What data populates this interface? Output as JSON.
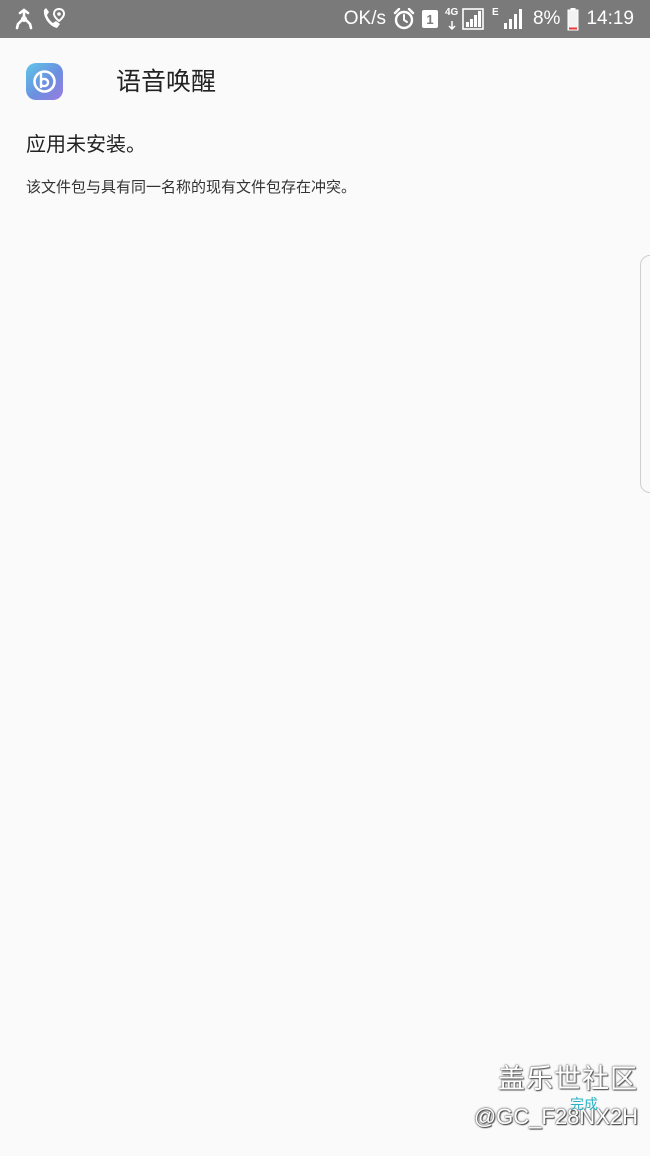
{
  "status_bar": {
    "network_speed": "OK/s",
    "sim_slot": "1",
    "network_4g": "4G",
    "network_e": "E",
    "battery_percent": "8%",
    "time": "14:19",
    "icons": [
      "usb-debug-icon",
      "wifi-calling-icon",
      "alarm-icon",
      "sim-slot-icon",
      "signal-4g-icon",
      "signal-e-icon",
      "battery-icon"
    ]
  },
  "app": {
    "title": "语音唤醒",
    "icon": "bixby-voice-icon"
  },
  "message": {
    "title": "应用未安装。",
    "body": "该文件包与具有同一名称的现有文件包存在冲突。"
  },
  "watermark": {
    "site": "盖乐世社区",
    "user": "@GC_F28NX2H"
  },
  "done_label": "完成",
  "colors": {
    "status_bar": "#7a7a7a",
    "background": "#fafafa",
    "done": "#2bb3c4"
  }
}
